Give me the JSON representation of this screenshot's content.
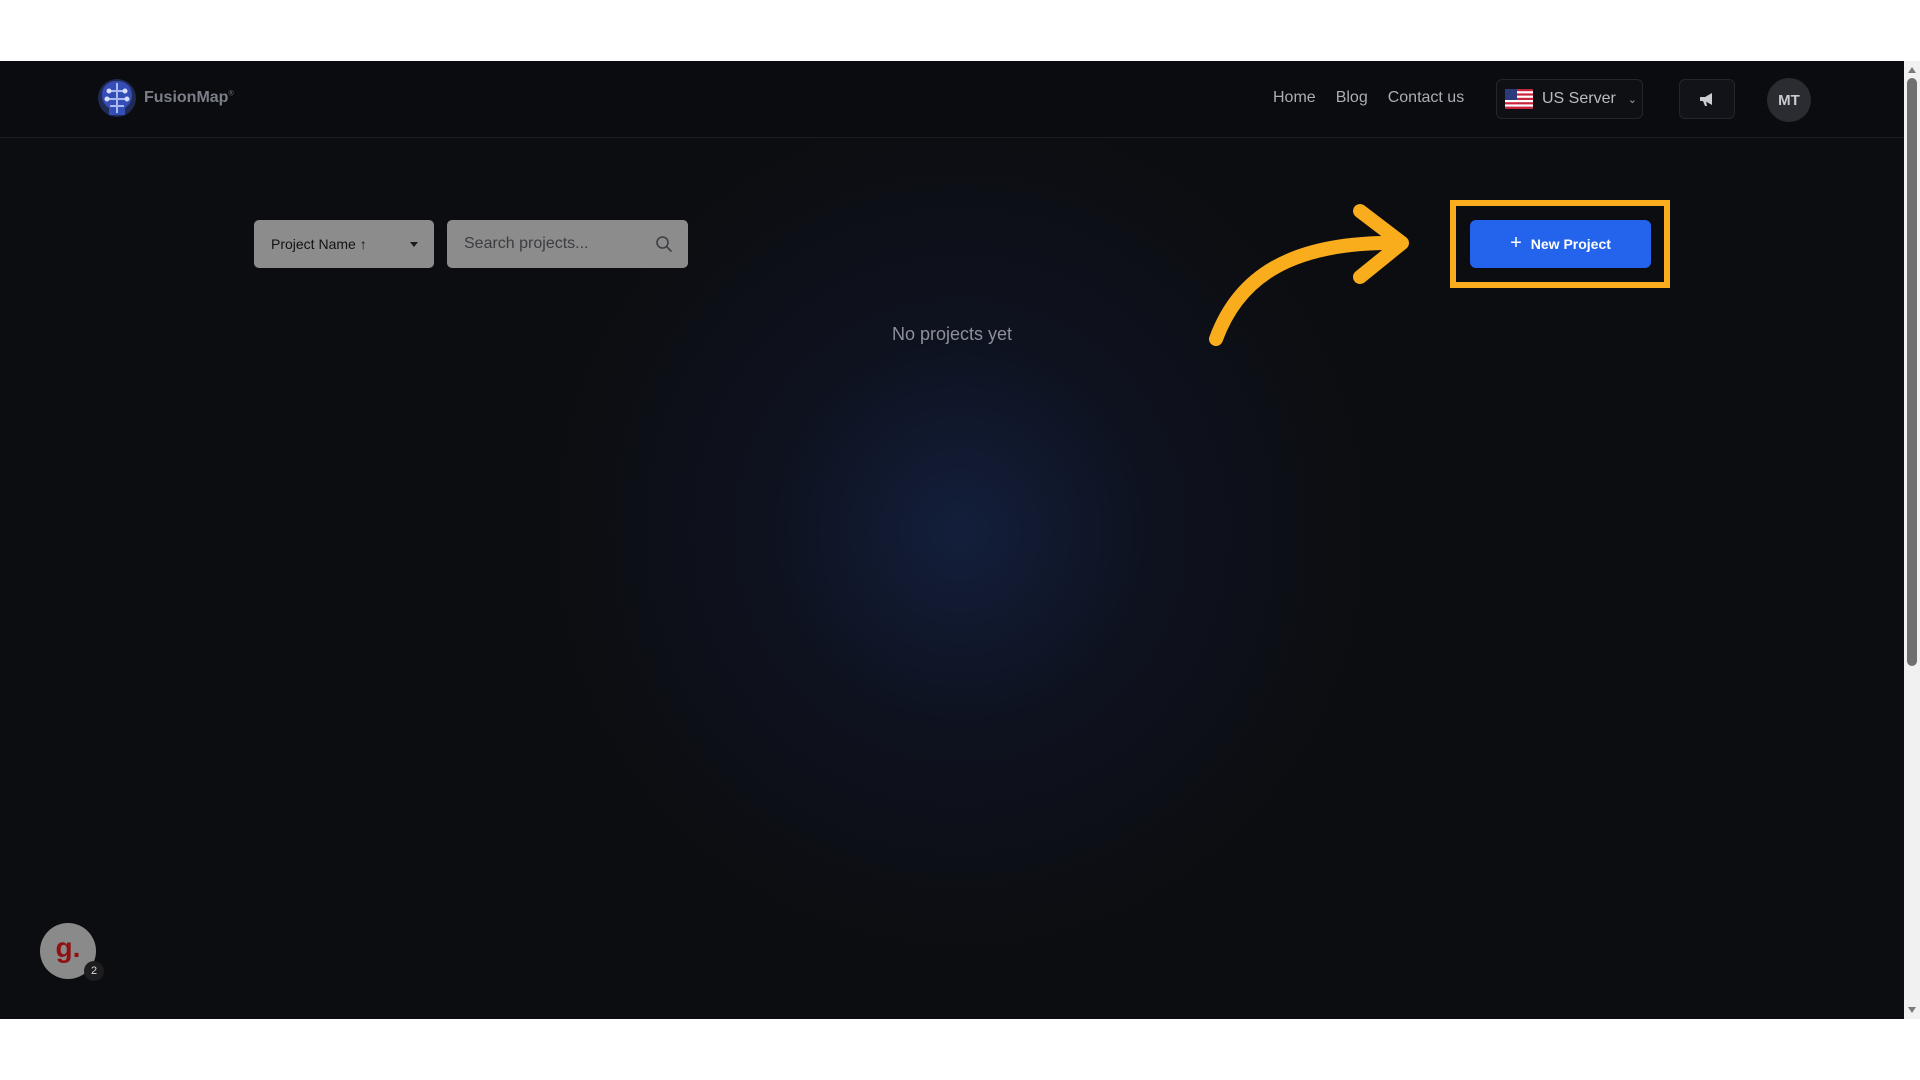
{
  "header": {
    "brand": "FusionMap",
    "brand_mark": "®",
    "nav": [
      {
        "label": "Home"
      },
      {
        "label": "Blog"
      },
      {
        "label": "Contact us"
      }
    ],
    "server": {
      "label": "US Server",
      "flag_icon": "us-flag-icon"
    },
    "announce_icon": "megaphone-icon",
    "avatar_initials": "MT"
  },
  "toolbar": {
    "sort_label": "Project Name ↑",
    "search_placeholder": "Search projects...",
    "new_project_label": "New Project"
  },
  "main": {
    "empty_message": "No projects yet"
  },
  "annotation": {
    "highlight_color": "#f9ad1d",
    "accent_color": "#2463eb"
  },
  "widget": {
    "glyph": "g.",
    "badge_count": "2"
  }
}
